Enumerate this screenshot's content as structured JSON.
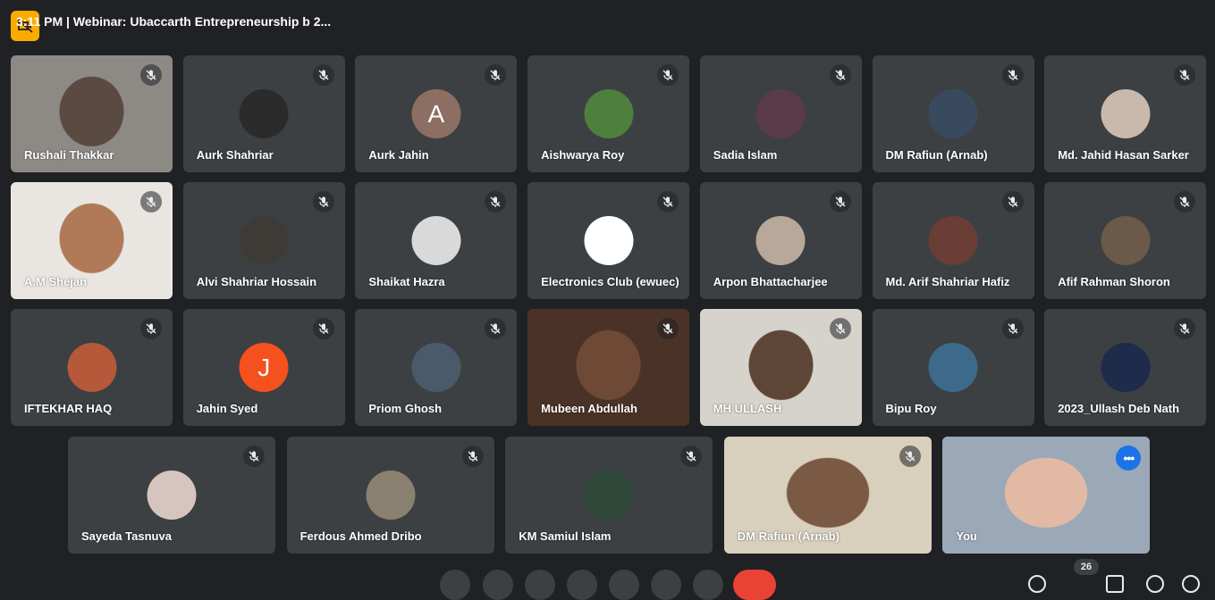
{
  "participants": [
    {
      "name": "Rushali Thakkar",
      "row": 0,
      "col": 0,
      "video": true,
      "bg": "#8d8a86",
      "face": "#5a4a42"
    },
    {
      "name": "Aurk Shahriar",
      "row": 0,
      "col": 1,
      "avatarColor": "#2b2b2b"
    },
    {
      "name": "Aurk Jahin",
      "row": 0,
      "col": 2,
      "letter": "A",
      "avatarColor": "#8d6e63"
    },
    {
      "name": "Aishwarya Roy",
      "row": 0,
      "col": 3,
      "avatarColor": "#4f7f3d"
    },
    {
      "name": "Sadia Islam",
      "row": 0,
      "col": 4,
      "avatarColor": "#5b3a4a"
    },
    {
      "name": "DM Rafiun (Arnab)",
      "row": 0,
      "col": 5,
      "avatarColor": "#3a4a5e"
    },
    {
      "name": "Md. Jahid Hasan Sarker",
      "row": 0,
      "col": 6,
      "avatarColor": "#c9b9ac"
    },
    {
      "name": "A.M Shejan",
      "row": 1,
      "col": 0,
      "video": true,
      "bg": "#e9e6e1",
      "face": "#b07a58"
    },
    {
      "name": "Alvi Shahriar Hossain",
      "row": 1,
      "col": 1,
      "avatarColor": "#3e3a35"
    },
    {
      "name": "Shaikat Hazra",
      "row": 1,
      "col": 2,
      "avatarColor": "#d9d9d9"
    },
    {
      "name": "Electronics Club (ewuec)",
      "row": 1,
      "col": 3,
      "avatarColor": "#ffffff"
    },
    {
      "name": "Arpon Bhattacharjee",
      "row": 1,
      "col": 4,
      "avatarColor": "#b7a89a"
    },
    {
      "name": "Md. Arif Shahriar Hafiz",
      "row": 1,
      "col": 5,
      "avatarColor": "#6a3d35"
    },
    {
      "name": "Afif Rahman Shoron",
      "row": 1,
      "col": 6,
      "avatarColor": "#6b5a4a"
    },
    {
      "name": "IFTEKHAR HAQ",
      "row": 2,
      "col": 0,
      "avatarColor": "#b5593a"
    },
    {
      "name": "Jahin Syed",
      "row": 2,
      "col": 1,
      "letter": "J",
      "avatarColor": "#f4511e"
    },
    {
      "name": "Priom Ghosh",
      "row": 2,
      "col": 2,
      "avatarColor": "#4a5a6a"
    },
    {
      "name": "Mubeen Abdullah",
      "row": 2,
      "col": 3,
      "video": true,
      "bg": "#4a3226",
      "face": "#6e4a36"
    },
    {
      "name": "MH ULLASH",
      "row": 2,
      "col": 4,
      "video": true,
      "bg": "#d6d2cc",
      "face": "#5e4636"
    },
    {
      "name": "Bipu Roy",
      "row": 2,
      "col": 5,
      "avatarColor": "#3d6a8a"
    },
    {
      "name": "2023_Ullash Deb Nath",
      "row": 2,
      "col": 6,
      "avatarColor": "#1e2b4a"
    },
    {
      "name": "Sayeda Tasnuva",
      "row": 3,
      "col": 0,
      "avatarColor": "#d6c5be"
    },
    {
      "name": "Ferdous Ahmed Dribo",
      "row": 3,
      "col": 1,
      "avatarColor": "#8a8070"
    },
    {
      "name": "KM Samiul Islam",
      "row": 3,
      "col": 2,
      "avatarColor": "#2f4a3a"
    },
    {
      "name": "DM Rafiun (Arnab)",
      "row": 3,
      "col": 3,
      "video": true,
      "bg": "#d9cfbd",
      "face": "#7a5a44"
    },
    {
      "name": "You",
      "row": 3,
      "col": 4,
      "video": true,
      "bg": "#9aa8b8",
      "face": "#e2b9a4",
      "speaking": true,
      "self": true
    }
  ],
  "participant_count": "26",
  "bottom": {
    "time_meeting": "3:11 PM | Webinar: Ubaccarth Entrepreneurship b 2..."
  },
  "colors": {
    "background": "#202124",
    "tile": "#3c4043",
    "accent": "#8ab4f8",
    "end_call": "#ea4335",
    "warning": "#f9ab00"
  },
  "icons": {
    "mic": "mic-off-icon",
    "top": "camera-off-icon",
    "more": "more-options-icon"
  }
}
